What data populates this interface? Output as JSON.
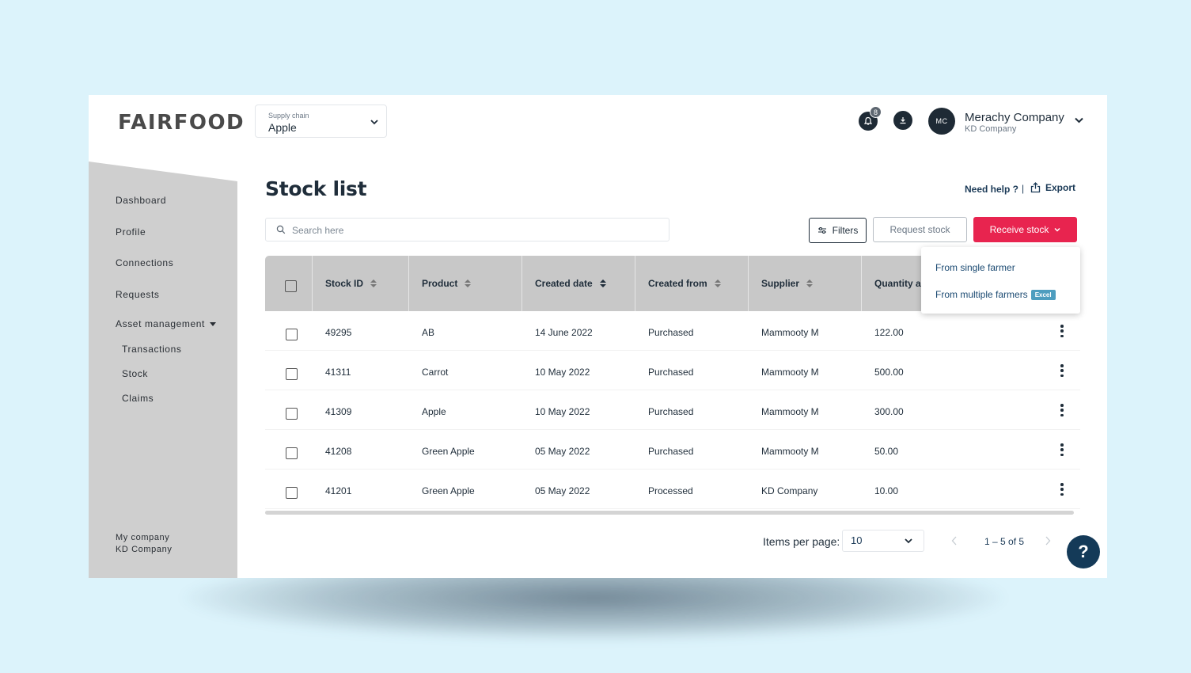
{
  "header": {
    "logo": "FAIRFOOD",
    "supply_chain_label": "Supply chain",
    "supply_chain_value": "Apple",
    "notification_count": "8",
    "user_initials": "MC",
    "user_name": "Merachy Company",
    "user_company": "KD Company"
  },
  "sidebar": {
    "items": [
      {
        "label": "Dashboard"
      },
      {
        "label": "Profile"
      },
      {
        "label": "Connections"
      },
      {
        "label": "Requests"
      },
      {
        "label": "Asset management"
      }
    ],
    "sub_items": [
      {
        "label": "Transactions"
      },
      {
        "label": "Stock"
      },
      {
        "label": "Claims"
      }
    ],
    "footer_label": "My company",
    "footer_company": "KD Company"
  },
  "main": {
    "title": "Stock list",
    "help_link": "Need help ?",
    "separator": "|",
    "export_label": "Export",
    "search_placeholder": "Search here",
    "filters_label": "Filters",
    "request_stock_label": "Request stock",
    "receive_stock_label": "Receive stock"
  },
  "dropdown": {
    "items": [
      {
        "label": "From single farmer"
      },
      {
        "label": "From multiple farmers",
        "badge": "Excel"
      }
    ]
  },
  "table": {
    "columns": [
      {
        "label": "Stock ID"
      },
      {
        "label": "Product"
      },
      {
        "label": "Created date"
      },
      {
        "label": "Created from"
      },
      {
        "label": "Supplier"
      },
      {
        "label": "Quantity a"
      }
    ],
    "rows": [
      {
        "id": "49295",
        "product": "AB",
        "date": "14 June 2022",
        "from": "Purchased",
        "supplier": "Mammooty M",
        "qty": "122.00"
      },
      {
        "id": "41311",
        "product": "Carrot",
        "date": "10 May 2022",
        "from": "Purchased",
        "supplier": "Mammooty M",
        "qty": "500.00"
      },
      {
        "id": "41309",
        "product": "Apple",
        "date": "10 May 2022",
        "from": "Purchased",
        "supplier": "Mammooty M",
        "qty": "300.00"
      },
      {
        "id": "41208",
        "product": "Green Apple",
        "date": "05 May 2022",
        "from": "Purchased",
        "supplier": "Mammooty M",
        "qty": "50.00"
      },
      {
        "id": "41201",
        "product": "Green Apple",
        "date": "05 May 2022",
        "from": "Processed",
        "supplier": "KD Company",
        "qty": "10.00"
      }
    ]
  },
  "pagination": {
    "items_per_page_label": "Items per page:",
    "items_per_page_value": "10",
    "range": "1 – 5 of 5"
  },
  "help_fab": "?",
  "colors": {
    "accent": "#e8244f",
    "navy": "#143a58",
    "sidebar": "#cfcfcf",
    "background": "#dcf3fb"
  }
}
